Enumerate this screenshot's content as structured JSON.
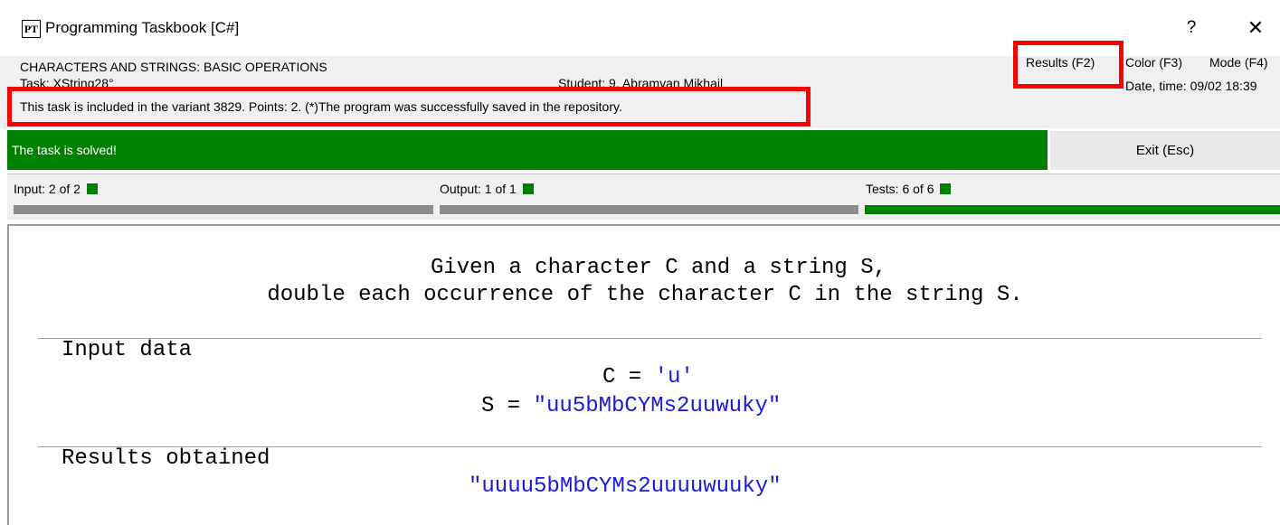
{
  "window": {
    "icon_label": "PT",
    "title": "Programming Taskbook [C#]",
    "help_label": "?",
    "close_label": "✕"
  },
  "header": {
    "section": "CHARACTERS AND STRINGS: BASIC OPERATIONS",
    "task": "Task: XString28°",
    "student": "Student: 9. Abramyan Mikhail",
    "info": "This task is included in the variant 3829. Points: 2. (*)The program was successfully saved in the repository.",
    "results_label": "Results (F2)",
    "color_label": "Color (F3)",
    "mode_label": "Mode (F4)",
    "datetime": "Date, time: 09/02 18:39"
  },
  "status": {
    "solved_text": "The task is solved!",
    "exit_label": "Exit (Esc)"
  },
  "stats": {
    "input": "Input: 2 of 2",
    "output": "Output: 1 of 1",
    "tests": "Tests: 6 of 6",
    "input_progress": 1,
    "output_progress": 1,
    "tests_progress": 1
  },
  "task_text": {
    "line1": "Given a character C and a string S,",
    "line2": "double each occurrence of the character C in the string S."
  },
  "input_section": {
    "heading": "Input data",
    "c_label": "C = ",
    "c_value": "'u'",
    "s_label": "S = ",
    "s_value": "\"uu5bMbCYMs2uuwuky\""
  },
  "results_section": {
    "heading": "Results obtained",
    "value": "\"uuuu5bMbCYMs2uuuuwuuky\""
  },
  "colors": {
    "success_green": "#008000",
    "highlight_red": "#ff0000",
    "value_blue": "#1a1adc",
    "progress_gray": "#8c8c8c"
  }
}
